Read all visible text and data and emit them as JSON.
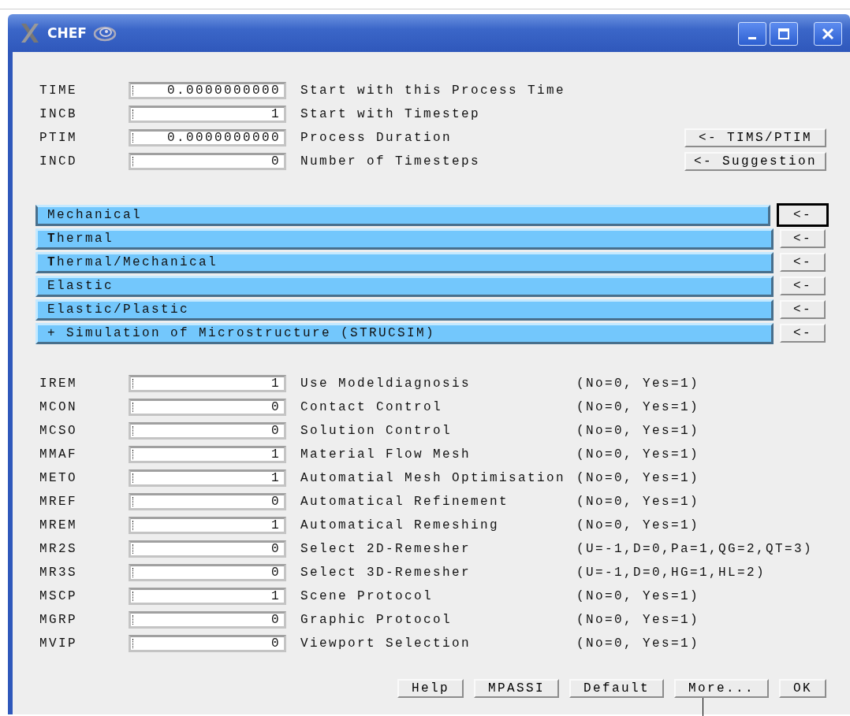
{
  "window": {
    "title": "CHEF"
  },
  "time_fields": [
    {
      "label": "TIME",
      "value": "0.0000000000",
      "description": "Start with this Process Time"
    },
    {
      "label": "INCB",
      "value": "1",
      "description": "Start with Timestep"
    },
    {
      "label": "PTIM",
      "value": "0.0000000000",
      "description": "Process Duration"
    },
    {
      "label": "INCD",
      "value": "0",
      "description": "Number of Timesteps"
    }
  ],
  "time_buttons": [
    "<- TIMS/PTIM",
    "<- Suggestion"
  ],
  "sections": [
    {
      "label": "Mechanical",
      "button": "<-",
      "focused": true
    },
    {
      "label": "**T**hermal",
      "button": "<-",
      "focused": false
    },
    {
      "label": "**T**hermal/Mechanical",
      "button": "<-",
      "focused": false
    },
    {
      "label": "Elastic",
      "button": "<-",
      "focused": false
    },
    {
      "label": "Elastic/Plastic",
      "button": "<-",
      "focused": false
    },
    {
      "label": "+ Simulation of Microstructure (STRUCSIM)",
      "button": "<-",
      "focused": false
    }
  ],
  "parameters": [
    {
      "label": "IREM",
      "value": "1",
      "description": "Use Modeldiagnosis",
      "hint": "(No=0, Yes=1)"
    },
    {
      "label": "MCON",
      "value": "0",
      "description": "Contact Control",
      "hint": "(No=0, Yes=1)"
    },
    {
      "label": "MCSO",
      "value": "0",
      "description": "Solution Control",
      "hint": "(No=0, Yes=1)"
    },
    {
      "label": "MMAF",
      "value": "1",
      "description": "Material Flow Mesh",
      "hint": "(No=0, Yes=1)"
    },
    {
      "label": "METO",
      "value": "1",
      "description": "Automatial Mesh Optimisation",
      "hint": "(No=0, Yes=1)"
    },
    {
      "label": "MREF",
      "value": "0",
      "description": "Automatical Refinement",
      "hint": "(No=0, Yes=1)"
    },
    {
      "label": "MREM",
      "value": "1",
      "description": "Automatical Remeshing",
      "hint": "(No=0, Yes=1)"
    },
    {
      "label": "MR2S",
      "value": "0",
      "description": "Select 2D-Remesher",
      "hint": "(U=-1,D=0,Pa=1,QG=2,QT=3)"
    },
    {
      "label": "MR3S",
      "value": "0",
      "description": "Select 3D-Remesher",
      "hint": "(U=-1,D=0,HG=1,HL=2)"
    },
    {
      "label": "MSCP",
      "value": "1",
      "description": "Scene Protocol",
      "hint": "(No=0, Yes=1)"
    },
    {
      "label": "MGRP",
      "value": "0",
      "description": "Graphic Protocol",
      "hint": "(No=0, Yes=1)"
    },
    {
      "label": "MVIP",
      "value": "0",
      "description": "Viewport Selection",
      "hint": "(No=0, Yes=1)"
    }
  ],
  "buttons": [
    "Help",
    "MPASSI",
    "Default",
    "More...",
    "OK"
  ]
}
